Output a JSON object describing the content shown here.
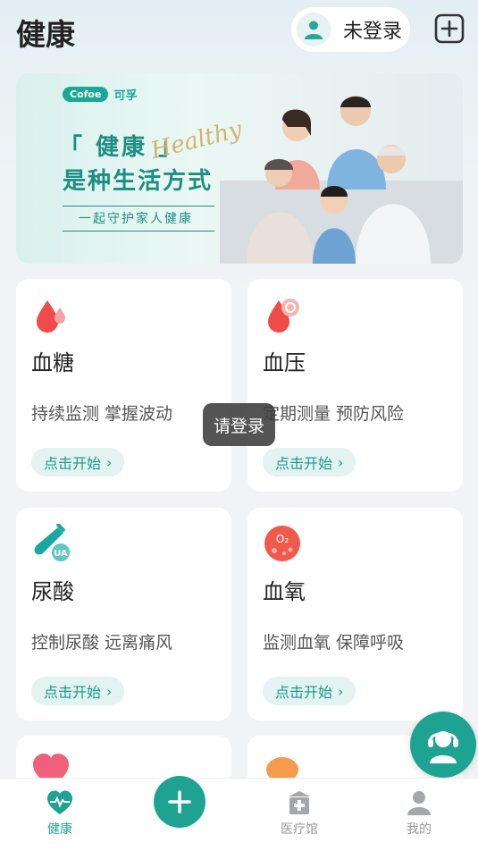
{
  "header": {
    "title": "健康",
    "login_label": "未登录"
  },
  "banner": {
    "brand_en": "Cofoe",
    "brand_cn": "可孚",
    "headline_1": "「 健康 」",
    "headline_2": "是种生活方式",
    "script_text": "Healthy",
    "tagline": "一起守护家人健康"
  },
  "cards": [
    {
      "title": "血糖",
      "desc": "持续监测 掌握波动",
      "button": "点击开始",
      "icon": "blood-drop-icon"
    },
    {
      "title": "血压",
      "desc": "定期测量 预防风险",
      "button": "点击开始",
      "icon": "blood-pressure-icon"
    },
    {
      "title": "尿酸",
      "desc": "控制尿酸 远离痛风",
      "button": "点击开始",
      "icon": "test-tube-ua-icon"
    },
    {
      "title": "血氧",
      "desc": "监测血氧 保障呼吸",
      "button": "点击开始",
      "icon": "oxygen-o2-icon"
    }
  ],
  "toast": "请登录",
  "tabbar": {
    "tabs": [
      {
        "label": "健康",
        "icon": "heart-pulse-icon",
        "active": true
      },
      {
        "label": "医疗馆",
        "icon": "clinic-icon",
        "active": false
      },
      {
        "label": "我的",
        "icon": "profile-icon",
        "active": false
      }
    ]
  },
  "colors": {
    "accent": "#1ea393",
    "background": "#f1f3f5",
    "red": "#ef4b4b"
  }
}
